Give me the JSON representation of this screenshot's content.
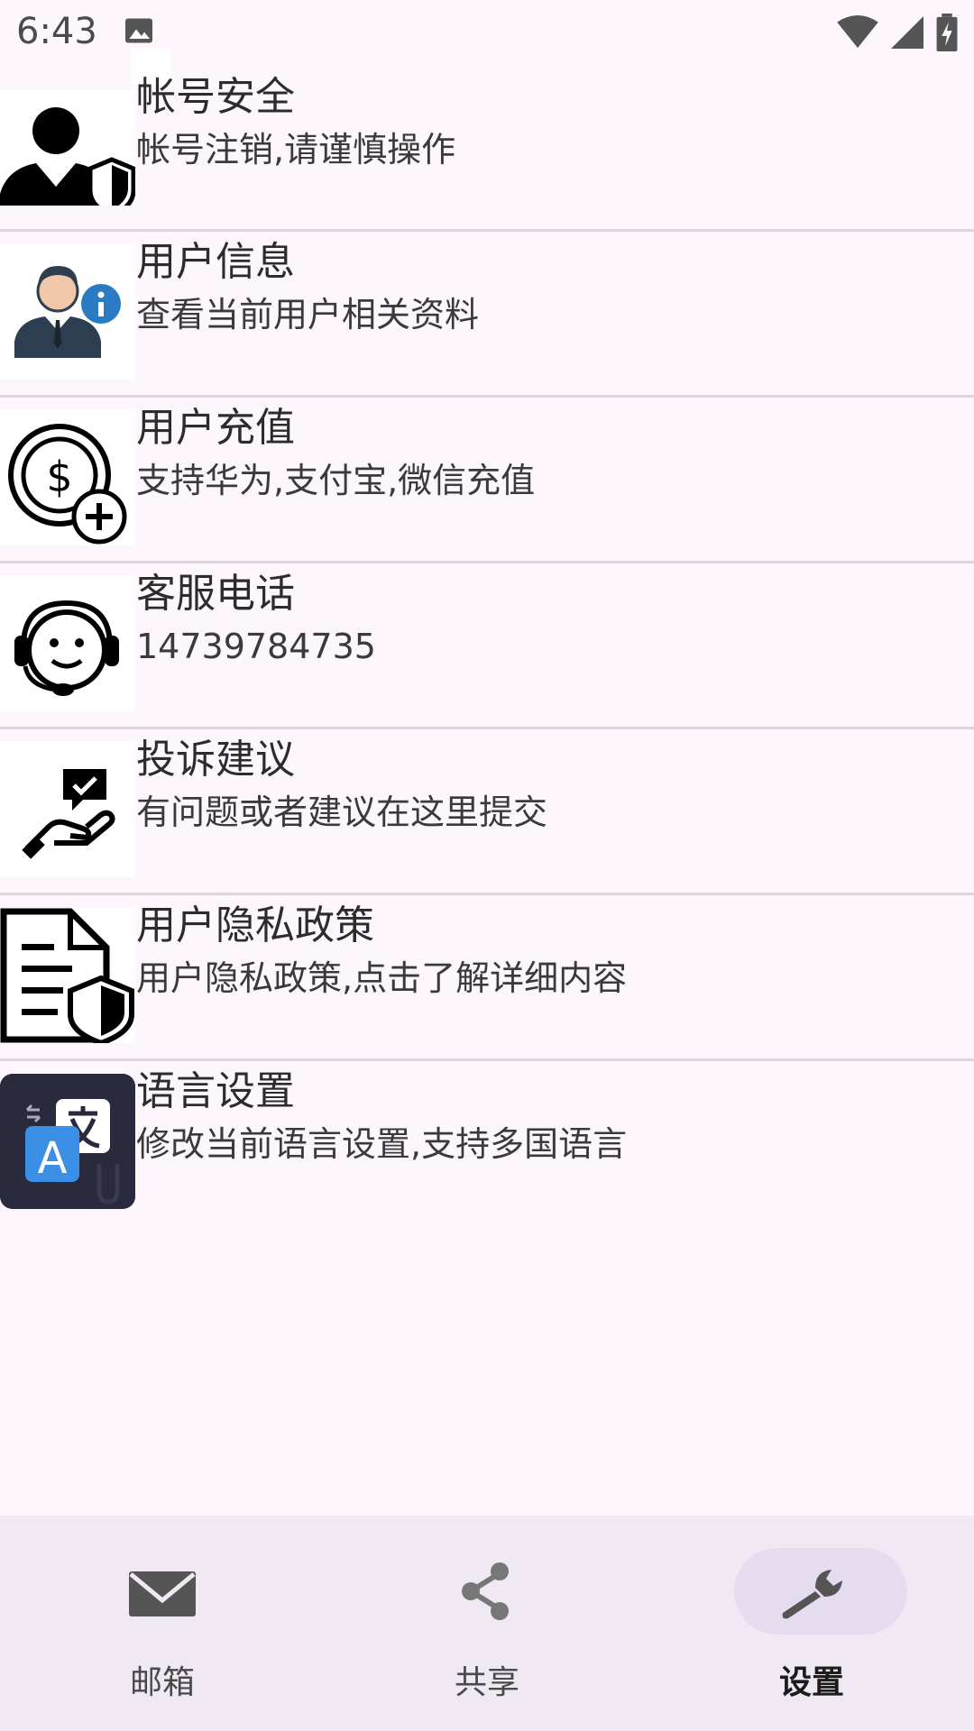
{
  "status_bar": {
    "time": "6:43"
  },
  "settings": {
    "items": [
      {
        "title": "帐号安全",
        "subtitle": "帐号注销,请谨慎操作",
        "icon": "account-security-icon"
      },
      {
        "title": "用户信息",
        "subtitle": "查看当前用户相关资料",
        "icon": "user-info-icon"
      },
      {
        "title": "用户充值",
        "subtitle": "支持华为,支付宝,微信充值",
        "icon": "recharge-icon"
      },
      {
        "title": "客服电话",
        "subtitle": "14739784735",
        "icon": "customer-service-icon"
      },
      {
        "title": "投诉建议",
        "subtitle": "有问题或者建议在这里提交",
        "icon": "feedback-icon"
      },
      {
        "title": "用户隐私政策",
        "subtitle": "用户隐私政策,点击了解详细内容",
        "icon": "privacy-policy-icon"
      },
      {
        "title": "语言设置",
        "subtitle": "修改当前语言设置,支持多国语言",
        "icon": "language-icon"
      }
    ]
  },
  "bottom_nav": {
    "items": [
      {
        "label": "邮箱",
        "icon": "mail-icon",
        "active": false
      },
      {
        "label": "共享",
        "icon": "share-icon",
        "active": false
      },
      {
        "label": "设置",
        "icon": "wrench-icon",
        "active": true
      }
    ]
  },
  "colors": {
    "background": "#fdf7fd",
    "nav_background": "#f0e9f3",
    "active_pill": "#e6dcf0",
    "divider": "#dcd6dc"
  }
}
